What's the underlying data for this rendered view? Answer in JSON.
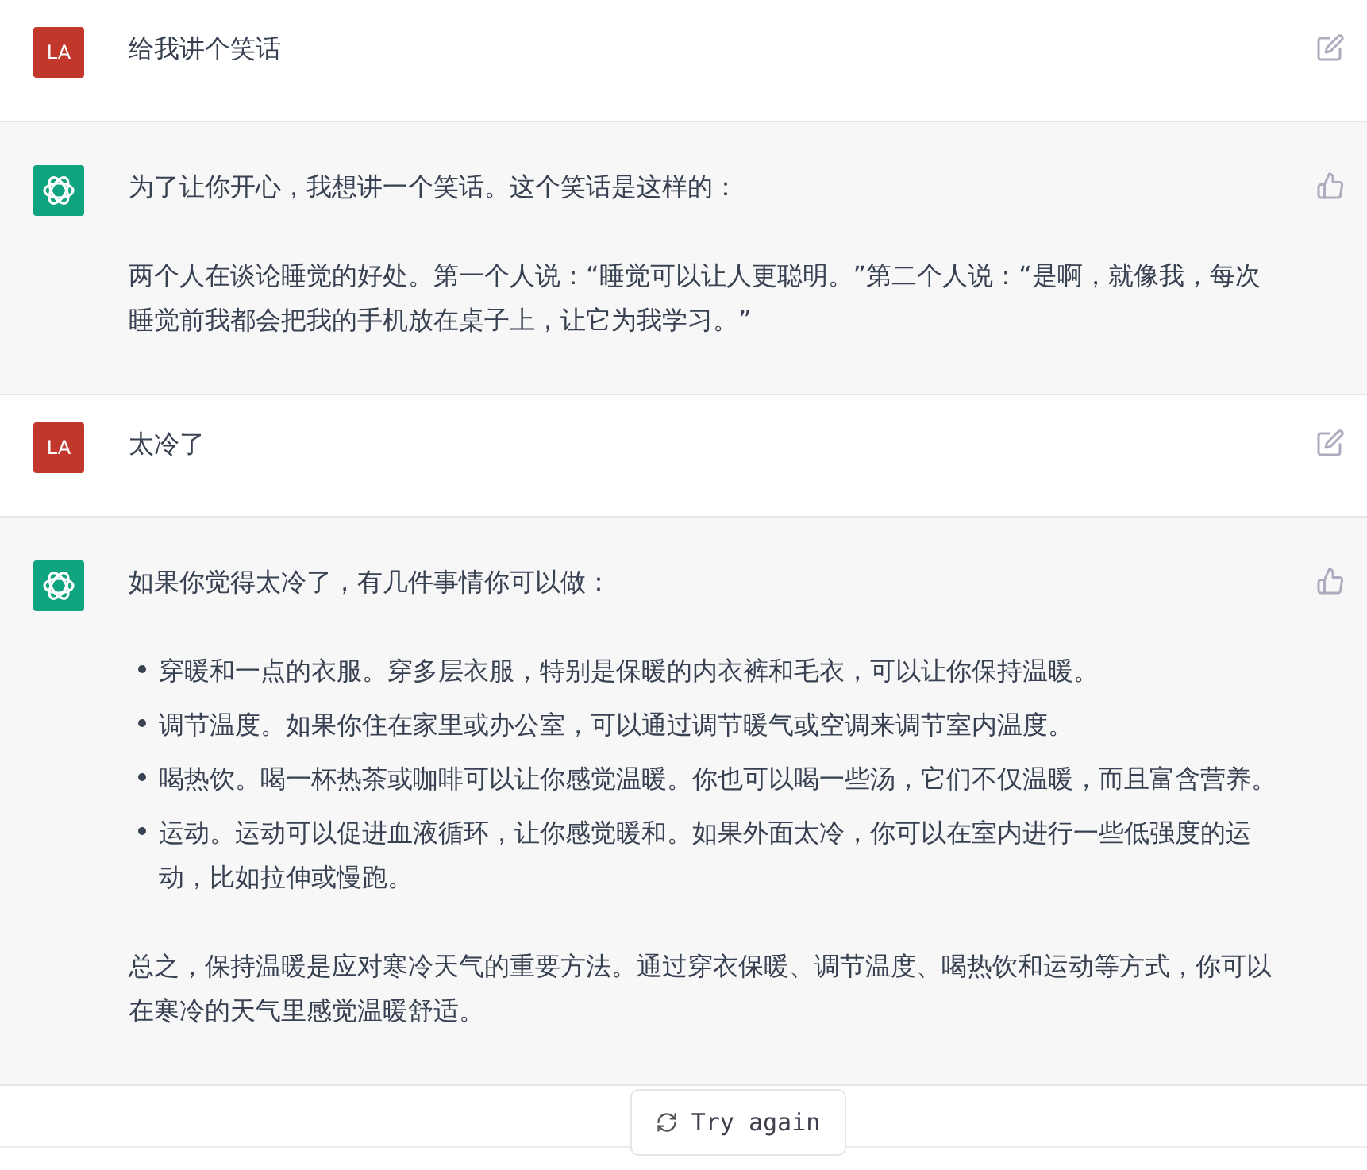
{
  "messages": [
    {
      "kind": "user",
      "avatar": "LA",
      "text": "给我讲个笑话"
    },
    {
      "kind": "assistant",
      "blocks": [
        {
          "kind": "paragraph",
          "text": "为了让你开心，我想讲一个笑话。这个笑话是这样的："
        },
        {
          "kind": "paragraph",
          "text": "两个人在谈论睡觉的好处。第一个人说：“睡觉可以让人更聪明。”第二个人说：“是啊，就像我，每次睡觉前我都会把我的手机放在桌子上，让它为我学习。”"
        }
      ]
    },
    {
      "kind": "user",
      "avatar": "LA",
      "text": "太冷了"
    },
    {
      "kind": "assistant",
      "blocks": [
        {
          "kind": "paragraph",
          "text": "如果你觉得太冷了，有几件事情你可以做："
        },
        {
          "kind": "list",
          "items": [
            "穿暖和一点的衣服。穿多层衣服，特别是保暖的内衣裤和毛衣，可以让你保持温暖。",
            "调节温度。如果你住在家里或办公室，可以通过调节暖气或空调来调节室内温度。",
            "喝热饮。喝一杯热茶或咖啡可以让你感觉温暖。你也可以喝一些汤，它们不仅温暖，而且富含营养。",
            "运动。运动可以促进血液循环，让你感觉暖和。如果外面太冷，你可以在室内进行一些低强度的运动，比如拉伸或慢跑。"
          ]
        },
        {
          "kind": "paragraph",
          "text": "总之，保持温暖是应对寒冷天气的重要方法。通过穿衣保暖、调节温度、喝热饮和运动等方式，你可以在寒冷的天气里感觉温暖舒适。"
        }
      ]
    }
  ],
  "try_again": "Try again"
}
